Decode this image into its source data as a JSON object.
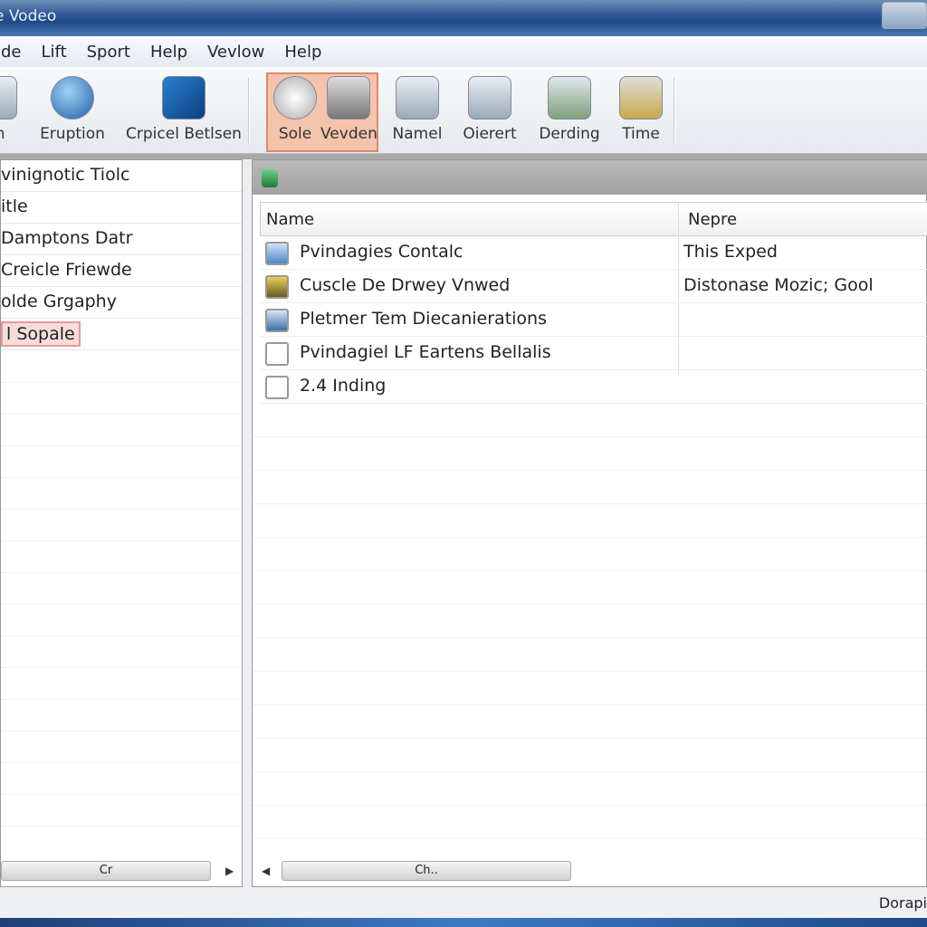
{
  "window": {
    "title": "e Vodeo"
  },
  "menu": [
    "ide",
    "Lift",
    "Sport",
    "Help",
    "Vevlow",
    "Help"
  ],
  "toolbar": [
    {
      "label": "on",
      "icon": "document-icon"
    },
    {
      "label": "Eruption",
      "icon": "globe-icon"
    },
    {
      "label": "Crpicel Betlsen",
      "icon": "drive-check-icon"
    },
    {
      "label": "Sole",
      "icon": "joystick-icon",
      "selected": true
    },
    {
      "label": "Vevden",
      "icon": "printer-icon",
      "selected": true
    },
    {
      "label": "Namel",
      "icon": "keyboard-icon"
    },
    {
      "label": "Oierert",
      "icon": "disc-icon"
    },
    {
      "label": "Derding",
      "icon": "tools-icon"
    },
    {
      "label": "Time",
      "icon": "bell-icon"
    }
  ],
  "left_list": [
    "vinignotic Tiolc",
    "itle",
    "Damptons Datr",
    "Creicle Friewde",
    "olde Grgaphy",
    "l Sopale"
  ],
  "left_selected_index": 5,
  "columns": [
    "Name",
    "Nepre"
  ],
  "rows": [
    {
      "name": "Pvindagies Contalc",
      "col2": "This Exped",
      "icon": "shortcut-icon"
    },
    {
      "name": "Cuscle De Drwey Vnwed",
      "col2": "Distonase Mozic; Gool",
      "icon": "image-icon"
    },
    {
      "name": "Pletmer Tem Diecanierations",
      "col2": "",
      "icon": "disk-icon"
    },
    {
      "name": "Pvindagiel LF Eartens Bellalis",
      "col2": "",
      "icon": "checkbox-icon"
    },
    {
      "name": "2.4 Inding",
      "col2": "",
      "icon": "checkbox-icon"
    }
  ],
  "left_scroll_label": "Cr",
  "right_scroll_label": "Ch..",
  "status": "Dorapi",
  "colors": {
    "titlebar": "#2f5a96",
    "selection": "#f6c3ad",
    "selection_border": "#e2876a"
  }
}
